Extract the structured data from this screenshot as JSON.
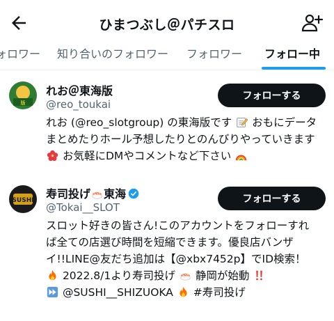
{
  "header": {
    "title": "ひまつぶし＠パチスロ",
    "back_icon": "arrow-left-icon",
    "add_user_icon": "person-add-icon"
  },
  "tabs": [
    {
      "label": "ォロワー",
      "active": false
    },
    {
      "label": "知り合いのフォロワー",
      "active": false
    },
    {
      "label": "フォロワー",
      "active": false
    },
    {
      "label": "フォロー中",
      "active": true
    }
  ],
  "users": [
    {
      "name": "れお＠東海版",
      "handle": "@reo_toukai",
      "follow_label": "フォローする",
      "bio_lines": [
        [
          "れお (@reo_slotgroup) の東海版です",
          "memo-emoji",
          "おもにデータ"
        ],
        [
          "まとめたりホール予想したりとのんびりやっていきます"
        ],
        [
          "",
          "hibiscus-emoji",
          "お気軽にDMやコメントなど下さい",
          "rainbow-emoji"
        ]
      ]
    },
    {
      "name_prefix": "寿司投げ",
      "name_suffix": "東海",
      "name_emoji": "sushi-emoji",
      "verified": true,
      "handle": "@Tokai__SLOT",
      "follow_label": "フォローする",
      "bio": {
        "line1": "スロット好きの皆さん!このアカウントをフォローすれ",
        "line2": "ば全ての店選び時間を短縮できます。優良店バンザ",
        "line3": "イ!!LINE@友だち追加は【@xbx7452p】でID検索！",
        "line4a": "2022.8/1より寿司投げ",
        "line4b": "静岡が始動",
        "line5a": "@SUSHI__SHIZUOKA",
        "line5b": "#寿司投げ"
      }
    }
  ],
  "colors": {
    "accent": "#1d9bf0",
    "text": "#0f1419",
    "secondary": "#536471",
    "button_bg": "#0f1419"
  }
}
